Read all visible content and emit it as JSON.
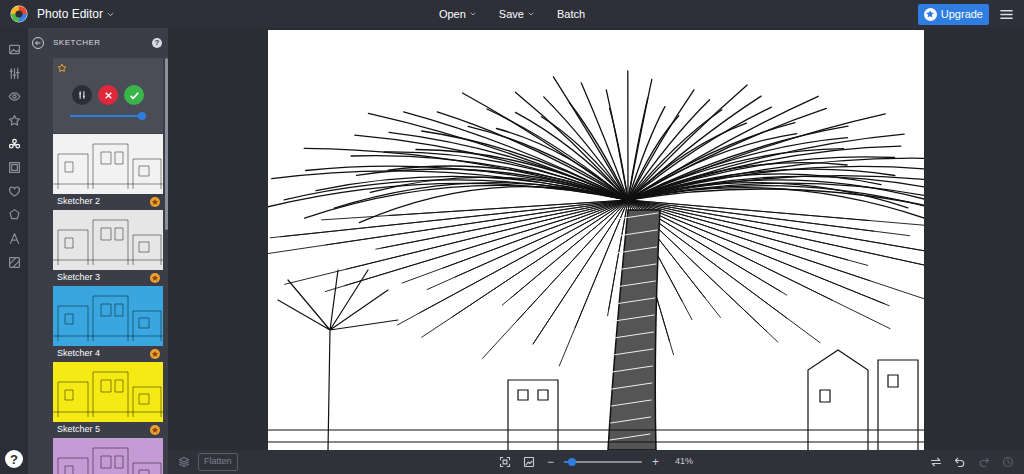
{
  "app": {
    "title": "Photo Editor"
  },
  "menu": [
    {
      "label": "Open",
      "kind": "dropdown"
    },
    {
      "label": "Save",
      "kind": "dropdown"
    },
    {
      "label": "Batch",
      "kind": "plain"
    }
  ],
  "upgrade": {
    "label": "Upgrade"
  },
  "tools": [
    {
      "selected": false
    },
    {
      "selected": false
    },
    {
      "selected": false
    },
    {
      "selected": false
    },
    {
      "selected": true
    },
    {
      "selected": false
    },
    {
      "selected": false
    },
    {
      "selected": false
    },
    {
      "selected": false
    },
    {
      "selected": false
    }
  ],
  "panel": {
    "title": "SKETCHER",
    "help": "?"
  },
  "active_preset": {
    "premium": true,
    "level": 0.95
  },
  "presets": [
    {
      "label": "Sketcher 2",
      "premium": true,
      "color": "#f2f2f2"
    },
    {
      "label": "Sketcher 3",
      "premium": true,
      "color": "#e6e6e6"
    },
    {
      "label": "Sketcher 4",
      "premium": true,
      "color": "#3aa6df"
    },
    {
      "label": "Sketcher 5",
      "premium": true,
      "color": "#f5ea14"
    },
    {
      "color": "#c59bd6"
    }
  ],
  "bottom_bar": {
    "flatten": "Flatten",
    "zoom": {
      "minus": "−",
      "plus": "+",
      "level": 0.1,
      "reading": "41%"
    },
    "redo_disabled": true,
    "history_disabled": true
  },
  "help_button": "?"
}
